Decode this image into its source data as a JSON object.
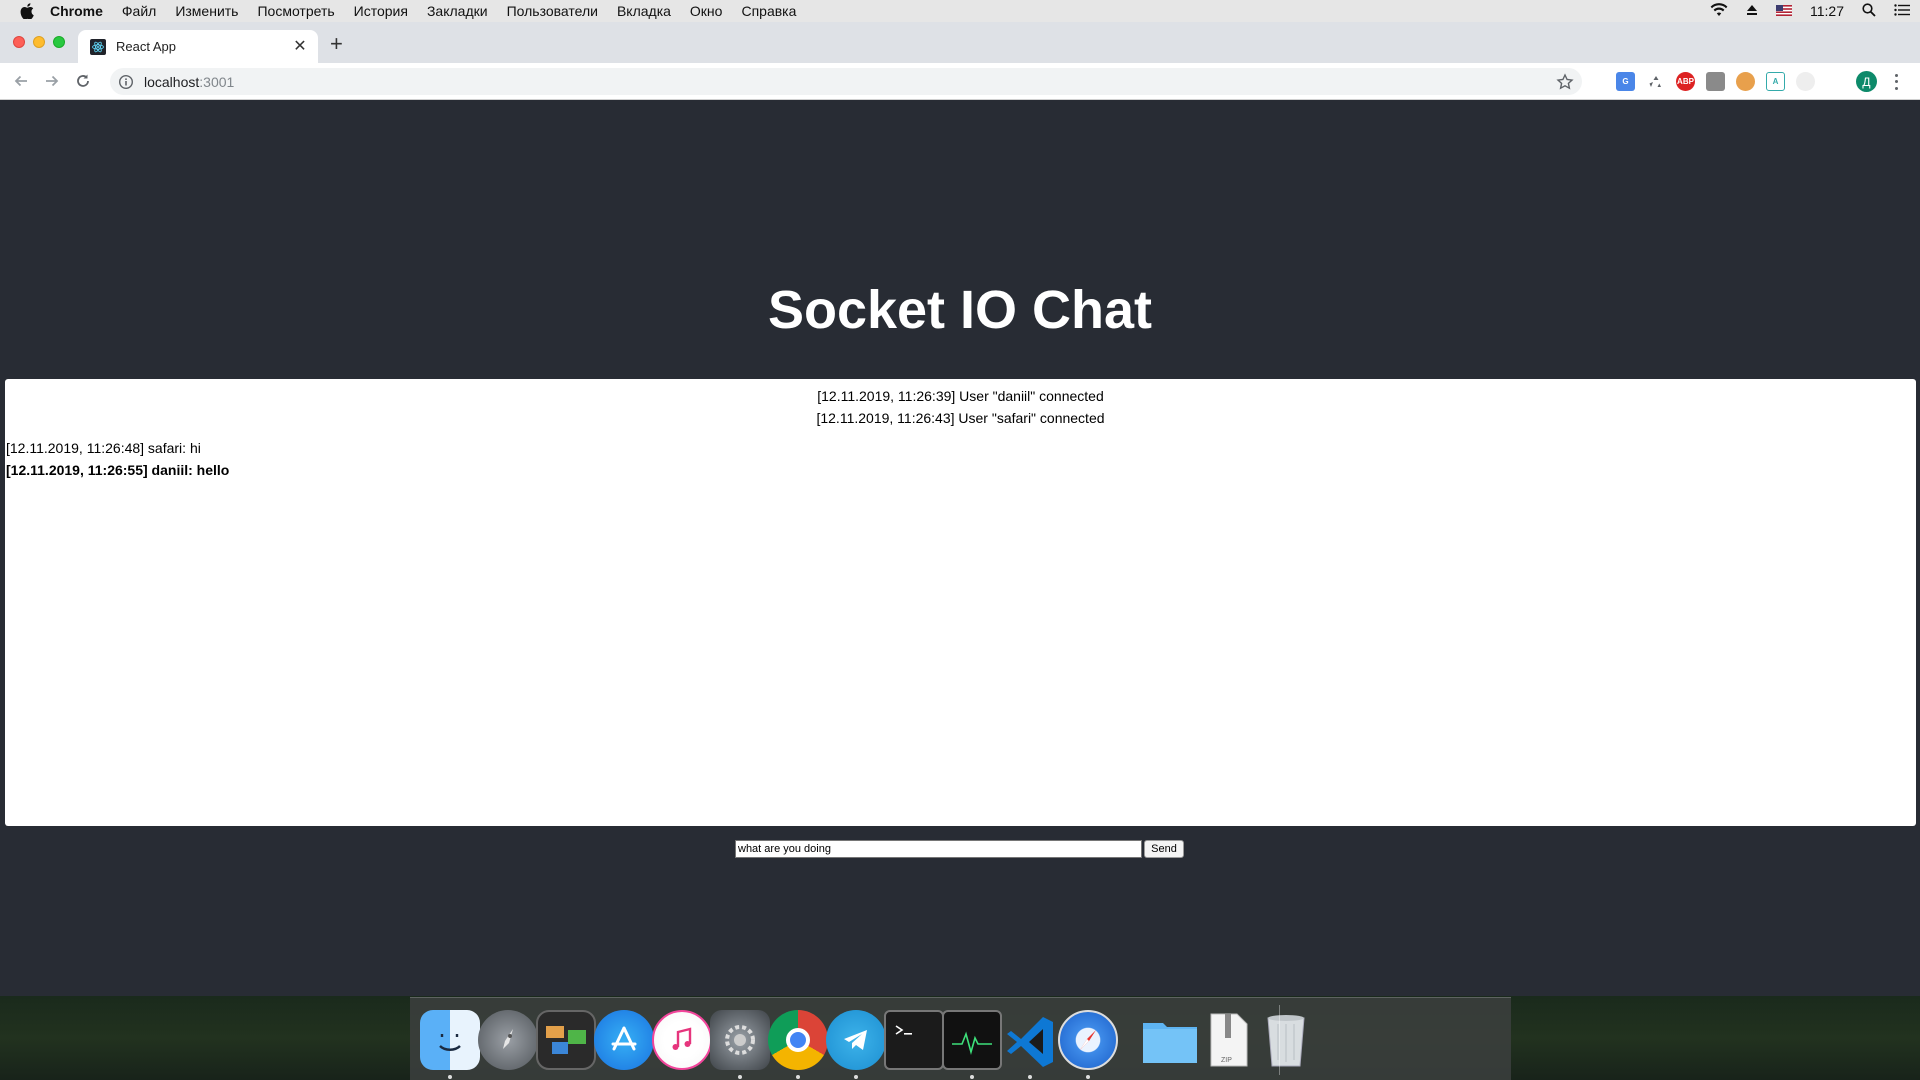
{
  "menubar": {
    "app_name": "Chrome",
    "items": [
      "Файл",
      "Изменить",
      "Посмотреть",
      "История",
      "Закладки",
      "Пользователи",
      "Вкладка",
      "Окно",
      "Справка"
    ],
    "clock": "11:27"
  },
  "browser": {
    "tab_title": "React App",
    "url_host": "localhost",
    "url_port": ":3001",
    "profile_initial": "Д"
  },
  "page": {
    "heading": "Socket IO Chat",
    "system_messages": [
      "[12.11.2019, 11:26:39] User \"daniil\" connected",
      "[12.11.2019, 11:26:43] User \"safari\" connected"
    ],
    "messages": [
      {
        "text": "[12.11.2019, 11:26:48] safari: hi"
      },
      {
        "text": "[12.11.2019, 11:26:55] daniil: hello"
      }
    ],
    "input_value": "what are you doing",
    "send_label": "Send"
  },
  "dock": {
    "apps": [
      "finder",
      "launchpad",
      "photo-slideshow",
      "app-store",
      "itunes",
      "system-preferences",
      "chrome",
      "telegram",
      "terminal",
      "activity-monitor",
      "vscode",
      "safari",
      "downloads-folder",
      "archive-utility",
      "trash"
    ]
  },
  "colors": {
    "page_background": "#282c34",
    "chat_background": "#ffffff",
    "heading_color": "#ffffff"
  }
}
